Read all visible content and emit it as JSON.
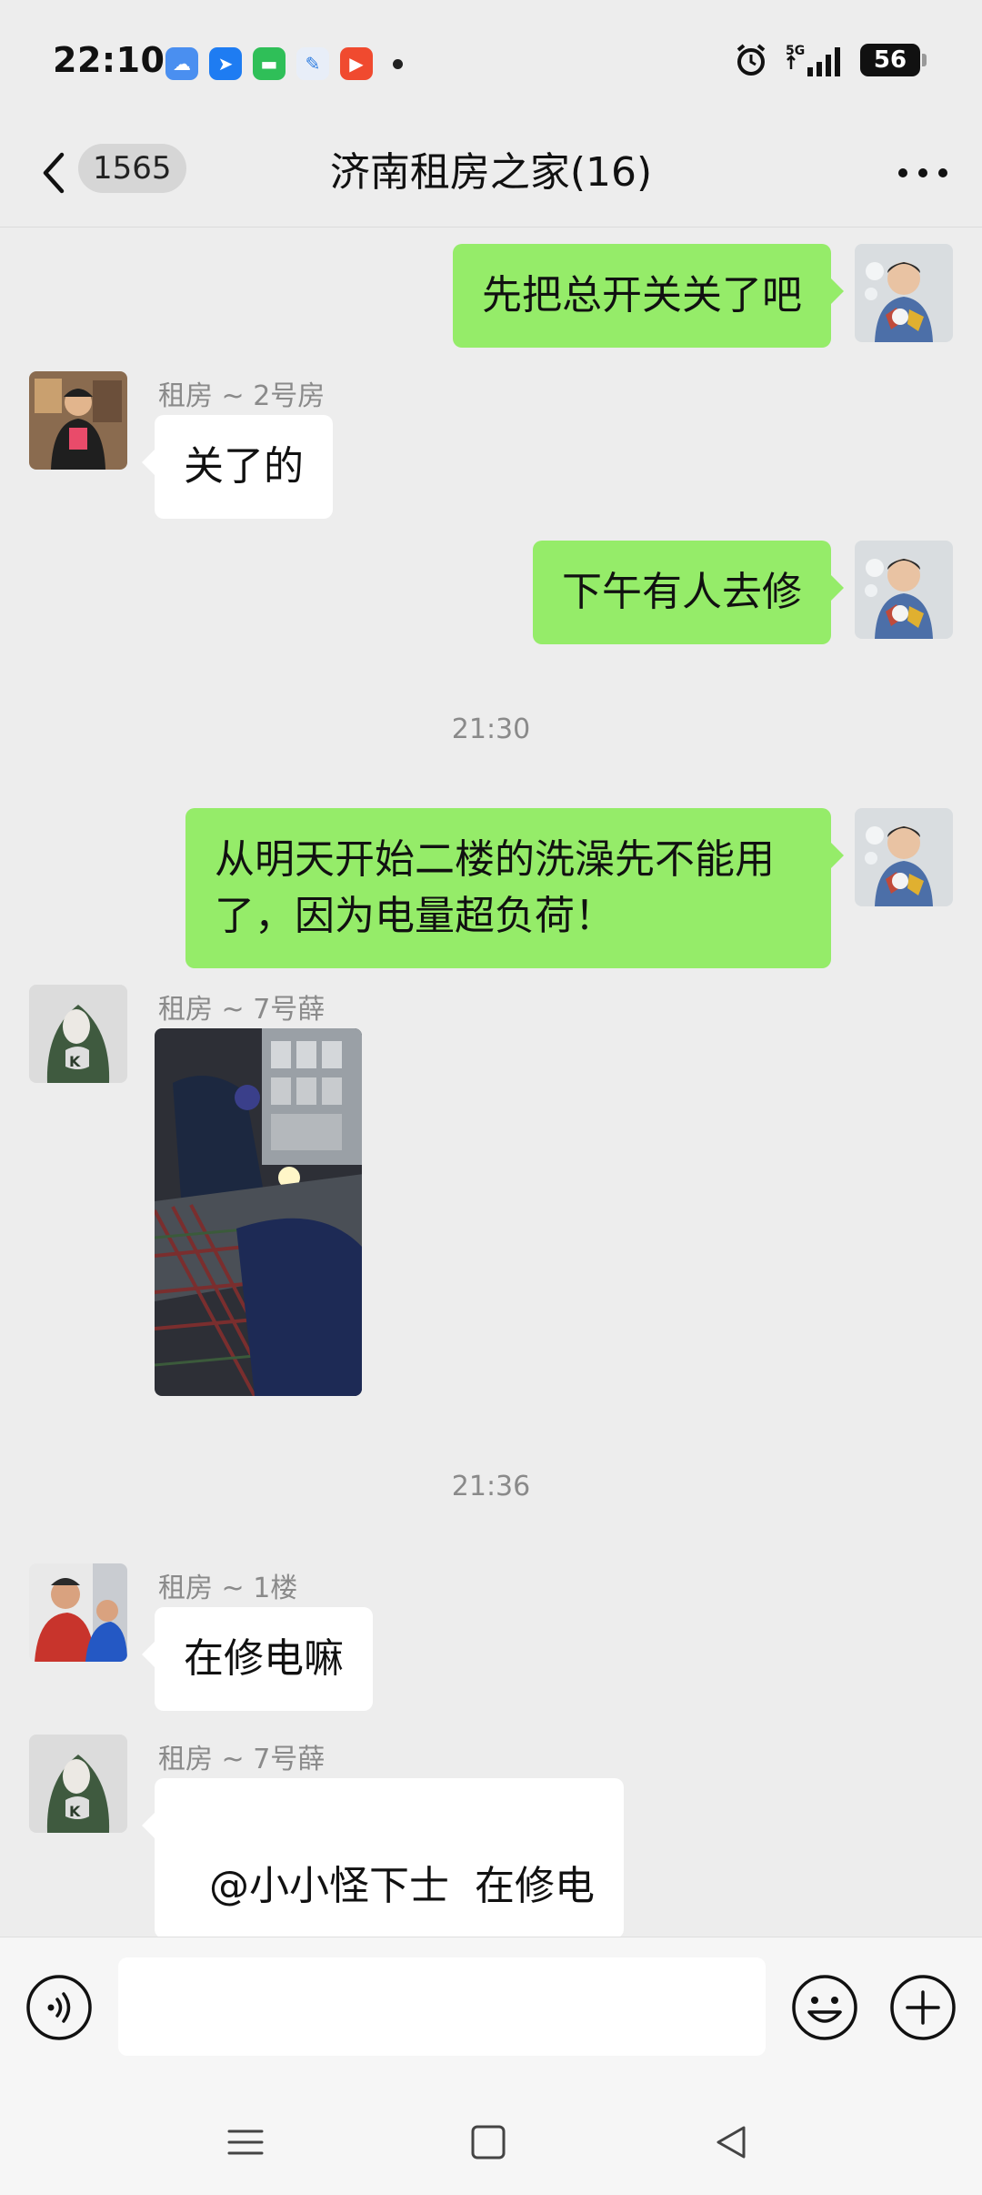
{
  "status_bar": {
    "time": "22:10",
    "battery_level": "56",
    "network": "5G",
    "notification_icons": [
      "weather-icon",
      "navigation-icon",
      "messages-icon",
      "feather-icon",
      "video-icon"
    ]
  },
  "header": {
    "unread_count": "1565",
    "title": "济南租房之家(16)"
  },
  "messages": [
    {
      "type": "text",
      "direction": "out",
      "text": "先把总开关关了吧"
    },
    {
      "type": "text",
      "direction": "in",
      "sender": "租房 ~ 2号房",
      "text": "关了的"
    },
    {
      "type": "text",
      "direction": "out",
      "text": "下午有人去修"
    },
    {
      "type": "time",
      "text": "21:30"
    },
    {
      "type": "text",
      "direction": "out",
      "lines": [
        "从明天开始二楼的洗澡先不能用",
        "了，因为电量超负荷！"
      ]
    },
    {
      "type": "image",
      "direction": "in",
      "sender": "租房 ~ 7号薛"
    },
    {
      "type": "time",
      "text": "21:36"
    },
    {
      "type": "text",
      "direction": "in",
      "sender": "租房 ~ 1楼",
      "text": "在修电嘛"
    },
    {
      "type": "text",
      "direction": "in",
      "sender": "租房 ~ 7号薛",
      "text": "@小小怪下士  在修电"
    }
  ],
  "input": {
    "value": "",
    "placeholder": ""
  },
  "colors": {
    "background": "#ededed",
    "outgoing_bubble": "#95ec69",
    "incoming_bubble": "#ffffff",
    "meta_text": "#8a8a8a"
  }
}
